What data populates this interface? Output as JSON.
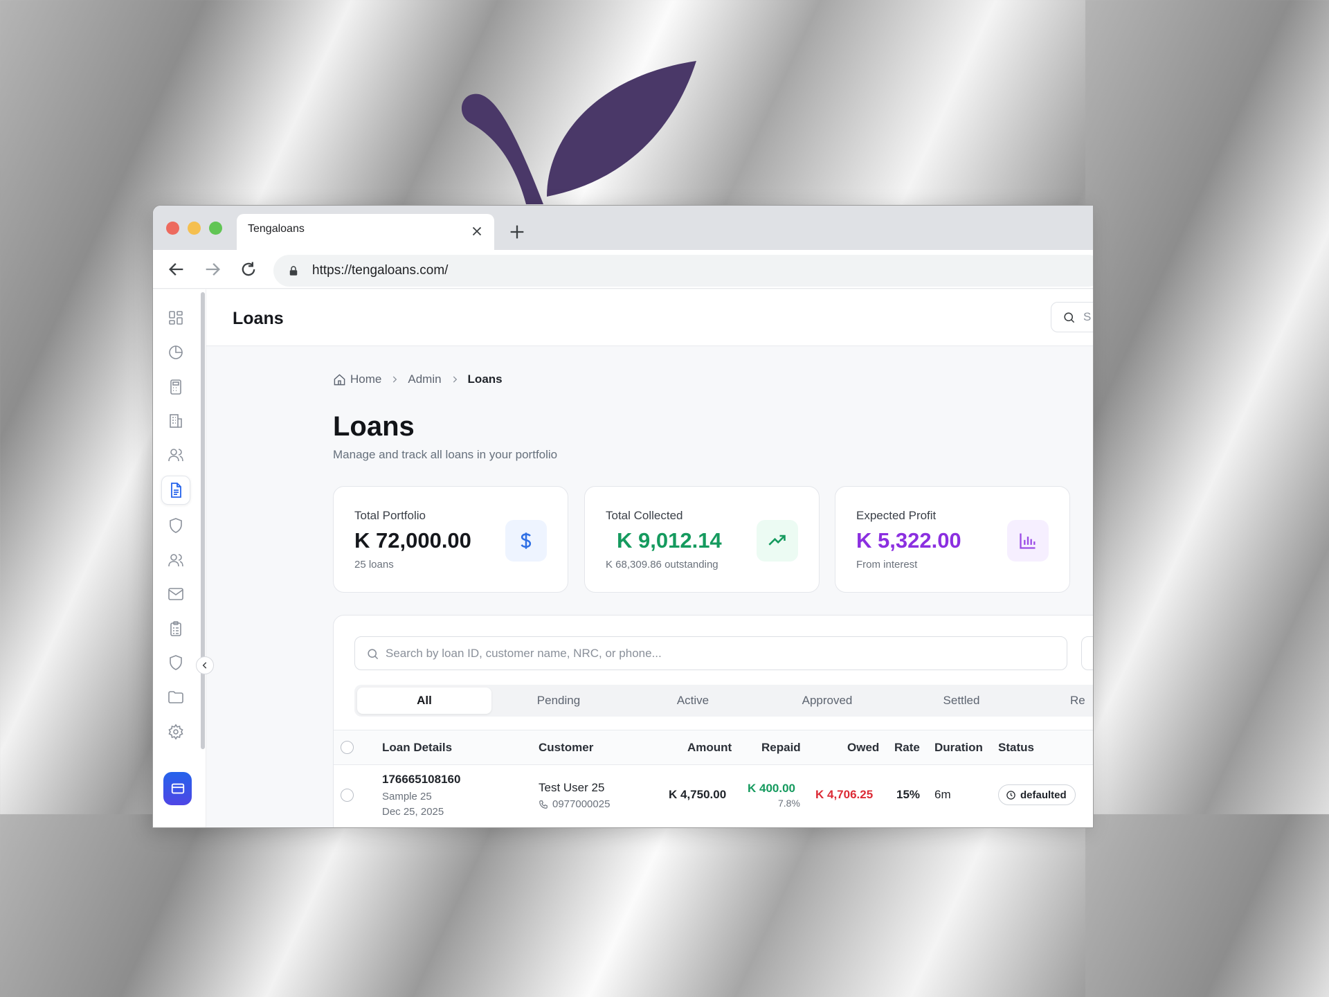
{
  "browser": {
    "tab_title": "Tengaloans",
    "url": "https://tengaloans.com/"
  },
  "header": {
    "title": "Loans",
    "search_placeholder": "S"
  },
  "breadcrumb": {
    "home": "Home",
    "admin": "Admin",
    "current": "Loans"
  },
  "page": {
    "title": "Loans",
    "subtitle": "Manage and track all loans in your portfolio"
  },
  "sidebar": {
    "items": [
      {
        "icon": "dashboard-icon"
      },
      {
        "icon": "pie-chart-icon"
      },
      {
        "icon": "calculator-icon"
      },
      {
        "icon": "building-icon"
      },
      {
        "icon": "users-icon"
      },
      {
        "icon": "document-icon",
        "active": true
      },
      {
        "icon": "shield-icon"
      },
      {
        "icon": "users-icon"
      },
      {
        "icon": "mail-icon"
      },
      {
        "icon": "clipboard-icon"
      },
      {
        "icon": "shield-icon"
      },
      {
        "icon": "folder-icon"
      },
      {
        "icon": "gear-icon"
      }
    ]
  },
  "stats": [
    {
      "label": "Total Portfolio",
      "value": "K 72,000.00",
      "sub": "25 loans",
      "icon": "dollar-icon",
      "color": "#15171c",
      "icon_color": "#2f6fe4",
      "icon_bg": "#eef4ff"
    },
    {
      "label": "Total Collected",
      "value": "K 9,012.14",
      "sub": "K 68,309.86 outstanding",
      "icon": "trending-up-icon",
      "color": "#159a5e",
      "icon_color": "#159a5e",
      "icon_bg": "#ecfbf3"
    },
    {
      "label": "Expected Profit",
      "value": "K 5,322.00",
      "sub": "From interest",
      "icon": "bar-chart-icon",
      "color": "#8b2fe0",
      "icon_color": "#9b4be6",
      "icon_bg": "#f6efff"
    }
  ],
  "search": {
    "placeholder": "Search by loan ID, customer name, NRC, or phone..."
  },
  "filter_tabs": [
    "All",
    "Pending",
    "Active",
    "Approved",
    "Settled",
    "Re"
  ],
  "table": {
    "headers": {
      "loan_details": "Loan Details",
      "customer": "Customer",
      "amount": "Amount",
      "repaid": "Repaid",
      "owed": "Owed",
      "rate": "Rate",
      "duration": "Duration",
      "status": "Status"
    },
    "rows": [
      {
        "loan_id": "176665108160",
        "sample": "Sample 25",
        "date": "Dec 25, 2025",
        "customer": "Test User 25",
        "phone": "0977000025",
        "amount": "K 4,750.00",
        "repaid": "K 400.00",
        "repaid_pct": "7.8%",
        "owed": "K 4,706.25",
        "rate": "15%",
        "duration": "6m",
        "status": "defaulted"
      }
    ]
  },
  "colors": {
    "accent": "#2563eb",
    "leaf": "#4a3868"
  }
}
